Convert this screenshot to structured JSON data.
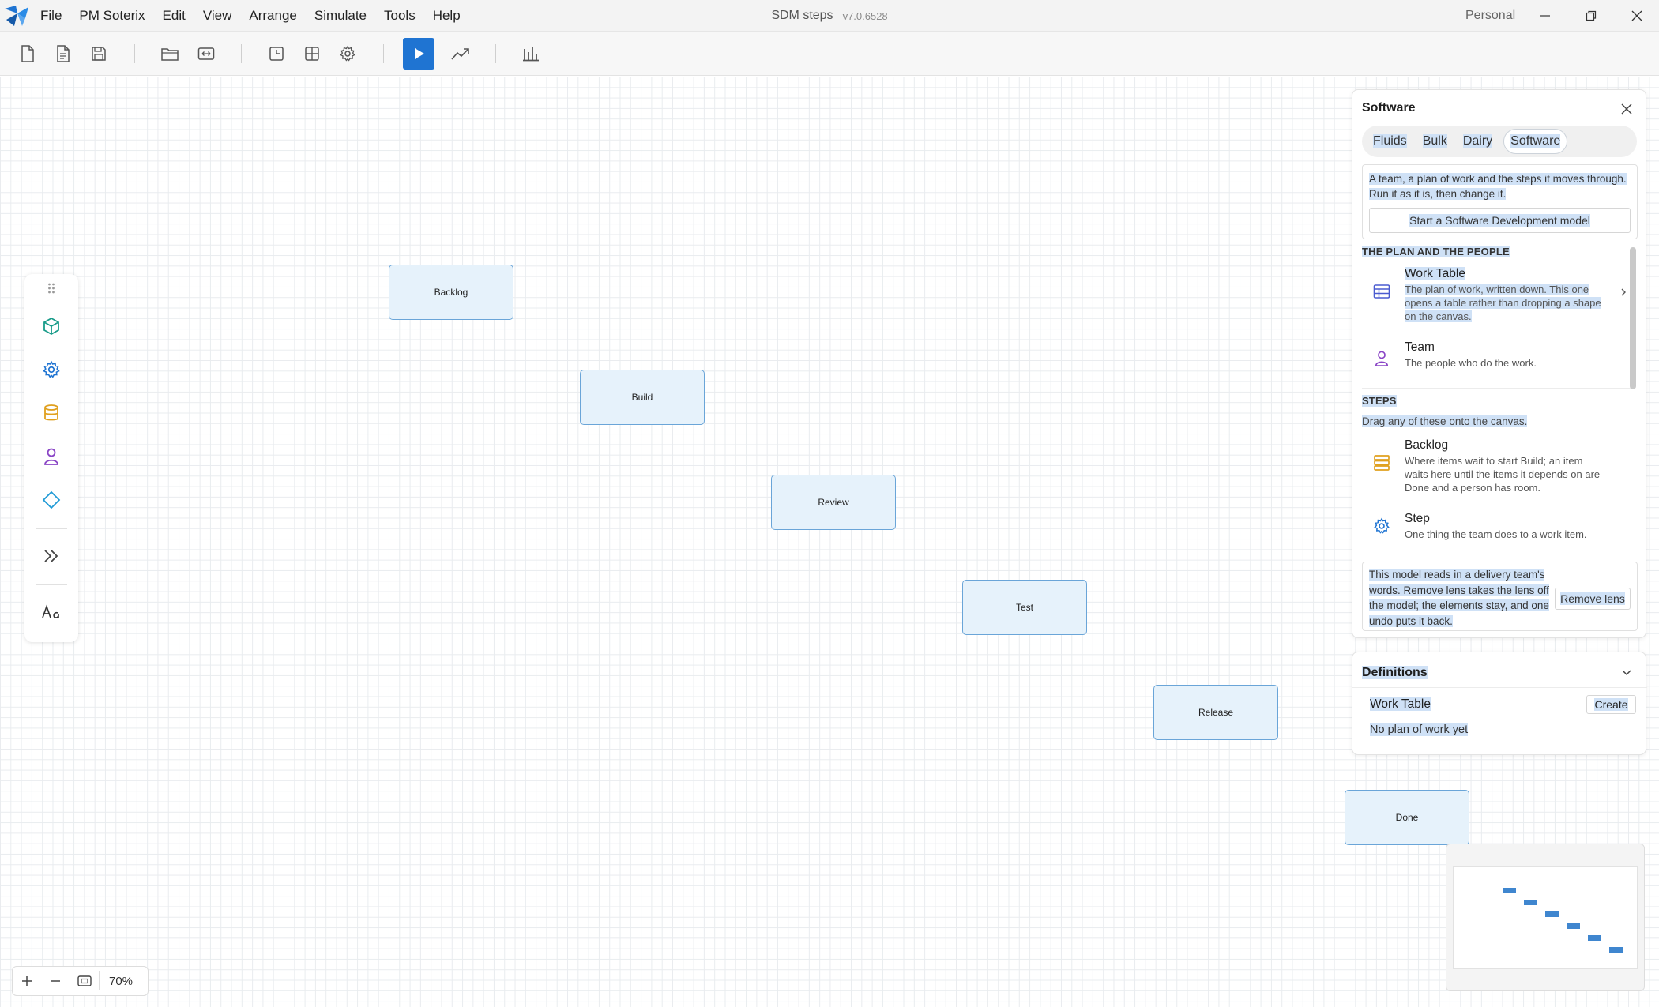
{
  "menu": [
    "File",
    "PM Soterix",
    "Edit",
    "View",
    "Arrange",
    "Simulate",
    "Tools",
    "Help"
  ],
  "window": {
    "title": "SDM steps",
    "version": "v7.0.6528",
    "account": "Personal"
  },
  "canvas": {
    "nodes": [
      "Backlog",
      "Build",
      "Review",
      "Test",
      "Release",
      "Done"
    ],
    "zoom": "70%"
  },
  "panel": {
    "title": "Software",
    "tabs": [
      "Fluids",
      "Bulk",
      "Dairy",
      "Software"
    ],
    "active_tab": "Software",
    "intro": "A team, a plan of work and the steps it moves through. Run it as it is, then change it.",
    "start_button": "Start a Software Development model",
    "sections": {
      "plan": "THE PLAN AND THE PEOPLE",
      "steps": "STEPS",
      "steps_note": "Drag any of these onto the canvas."
    },
    "items": [
      {
        "icon": "table-icon",
        "title": "Work Table",
        "desc": "The plan of work, written down. This one opens a table rather than dropping a shape on the canvas."
      },
      {
        "icon": "person-icon",
        "title": "Team",
        "desc": "The people who do the work."
      },
      {
        "icon": "stack-icon",
        "title": "Backlog",
        "desc": "Where items wait to start Build; an item waits here until the items it depends on are Done and a person has room."
      },
      {
        "icon": "gear-icon",
        "title": "Step",
        "desc": "One thing the team does to a work item."
      }
    ],
    "lens_text": "This model reads in a delivery team's words. Remove lens takes the lens off the model; the elements stay, and one undo puts it back.",
    "lens_button": "Remove lens"
  },
  "definitions": {
    "title": "Definitions",
    "row_title": "Work Table",
    "create_button": "Create",
    "empty_text": "No plan of work yet"
  },
  "colors": {
    "accent": "#1f74d2",
    "node_fill": "#e6f2fb",
    "node_border": "#6aa5d8",
    "selection": "#cfe1f6"
  }
}
